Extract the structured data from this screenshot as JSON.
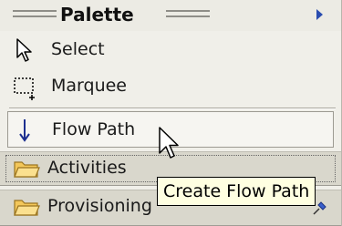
{
  "palette": {
    "title": "Palette",
    "tools": [
      {
        "label": "Select",
        "icon": "select-arrow-icon"
      },
      {
        "label": "Marquee",
        "icon": "marquee-icon"
      },
      {
        "label": "Flow Path",
        "icon": "flow-path-arrow-icon"
      }
    ],
    "drawers": [
      {
        "label": "Activities",
        "icon": "folder-icon"
      },
      {
        "label": "Provisioning",
        "icon": "folder-icon",
        "pin_icon": "pin-icon"
      }
    ],
    "tooltip": "Create Flow Path"
  },
  "colors": {
    "background": "#f0efe9",
    "drawer": "#d9d7cc",
    "tooltip_bg": "#ffffe1",
    "accent": "#2a4db0"
  }
}
